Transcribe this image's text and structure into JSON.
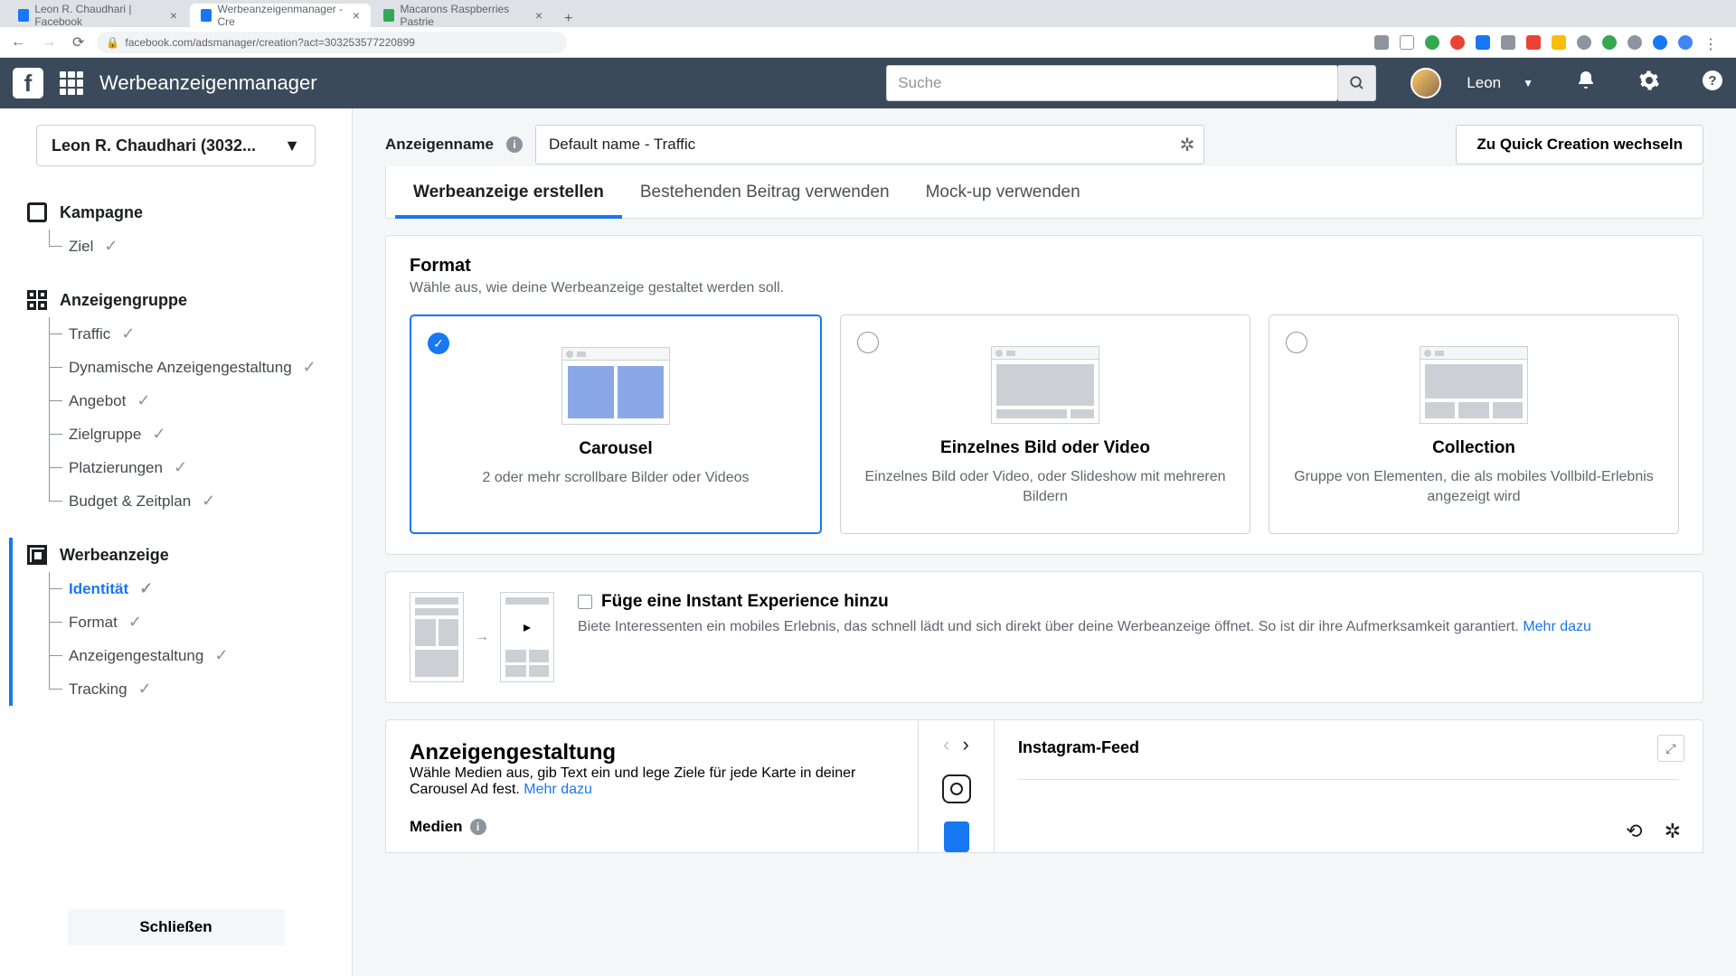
{
  "browser": {
    "tabs": [
      {
        "label": "Leon R. Chaudhari | Facebook",
        "favColor": "#1877f2"
      },
      {
        "label": "Werbeanzeigenmanager - Cre",
        "favColor": "#1877f2"
      },
      {
        "label": "Macarons Raspberries Pastrie",
        "favColor": "#34a853"
      }
    ],
    "url": "facebook.com/adsmanager/creation?act=303253577220899"
  },
  "header": {
    "appTitle": "Werbeanzeigenmanager",
    "searchPlaceholder": "Suche",
    "userName": "Leon"
  },
  "sidebar": {
    "account": "Leon R. Chaudhari (3032...",
    "sections": {
      "kampagne": {
        "title": "Kampagne",
        "items": [
          {
            "label": "Ziel"
          }
        ]
      },
      "anzeigengruppe": {
        "title": "Anzeigengruppe",
        "items": [
          {
            "label": "Traffic"
          },
          {
            "label": "Dynamische Anzeigengestaltung"
          },
          {
            "label": "Angebot"
          },
          {
            "label": "Zielgruppe"
          },
          {
            "label": "Platzierungen"
          },
          {
            "label": "Budget & Zeitplan"
          }
        ]
      },
      "werbeanzeige": {
        "title": "Werbeanzeige",
        "items": [
          {
            "label": "Identität",
            "active": true
          },
          {
            "label": "Format"
          },
          {
            "label": "Anzeigengestaltung"
          },
          {
            "label": "Tracking"
          }
        ]
      }
    },
    "closeButton": "Schließen"
  },
  "main": {
    "adNameLabel": "Anzeigenname",
    "adNameValue": "Default name - Traffic",
    "quickCreation": "Zu Quick Creation wechseln",
    "tabs": [
      {
        "label": "Werbeanzeige erstellen",
        "active": true
      },
      {
        "label": "Bestehenden Beitrag verwenden"
      },
      {
        "label": "Mock-up verwenden"
      }
    ],
    "format": {
      "title": "Format",
      "subtitle": "Wähle aus, wie deine Werbeanzeige gestaltet werden soll.",
      "options": [
        {
          "title": "Carousel",
          "desc": "2 oder mehr scrollbare Bilder oder Videos",
          "selected": true
        },
        {
          "title": "Einzelnes Bild oder Video",
          "desc": "Einzelnes Bild oder Video, oder Slideshow mit mehreren Bildern"
        },
        {
          "title": "Collection",
          "desc": "Gruppe von Elementen, die als mobiles Vollbild-Erlebnis angezeigt wird"
        }
      ]
    },
    "instantExp": {
      "title": "Füge eine Instant Experience hinzu",
      "desc": "Biete Interessenten ein mobiles Erlebnis, das schnell lädt und sich direkt über deine Werbeanzeige öffnet. So ist dir ihre Aufmerksamkeit garantiert. ",
      "more": "Mehr dazu"
    },
    "design": {
      "title": "Anzeigengestaltung",
      "desc": "Wähle Medien aus, gib Text ein und lege Ziele für jede Karte in deiner Carousel Ad fest. ",
      "more": "Mehr dazu",
      "medien": "Medien"
    },
    "preview": {
      "title": "Instagram-Feed"
    }
  }
}
